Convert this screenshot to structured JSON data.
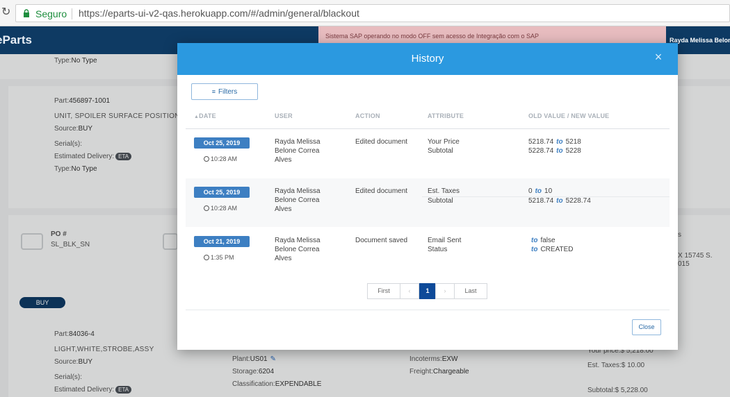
{
  "browser": {
    "secure_label": "Seguro",
    "url": "https://eparts-ui-v2-qas.herokuapp.com/#/admin/general/blackout"
  },
  "app": {
    "brand": "eParts",
    "banner": "Sistema SAP operando no modo OFF sem acesso de Integração com o SAP",
    "user": "Rayda Melissa Belone"
  },
  "background": {
    "type_label_1": "Type:",
    "type_value_1": "No Type",
    "part_label_1": "Part:",
    "part_value_1": "456897-1001",
    "desc_1": "UNIT, SPOILER SURFACE POSITION",
    "source_label_1": "Source:",
    "source_value_1": "BUY",
    "serials_1": "Serial(s):",
    "delivery_label_1": "Estimated Delivery:",
    "eta_1": "ETA",
    "type_label_2": "Type:",
    "type_value_2": "No Type",
    "po_label": "PO #",
    "po_value": "SL_BLK_SN",
    "buy_button": "BUY",
    "part_label_2": "Part:",
    "part_value_2": "84036-4",
    "desc_2": "LIGHT,WHITE,STROBE,ASSY",
    "source_label_2": "Source:",
    "source_value_2": "BUY",
    "serials_2": "Serial(s):",
    "delivery_label_2": "Estimated Delivery:",
    "eta_2": "ETA",
    "plant_label": "Plant:",
    "plant_value": "US01",
    "storage_label": "Storage:",
    "storage_value": "6204",
    "class_label": "Classification:",
    "class_value": "EXPENDABLE",
    "incoterms_label": "Incoterms:",
    "incoterms_value": "EXW",
    "freight_label": "Freight:",
    "freight_value": "Chargeable",
    "your_price": "Your price:$ 5,218.00",
    "est_taxes": "Est. Taxes:$ 10.00",
    "subtotal": "Subtotal:$ 5,228.00",
    "address_partial": "X 15745 S.",
    "address_partial_2": "015",
    "s_partial": "s"
  },
  "modal": {
    "title": "History",
    "filters_label": "Filters",
    "columns": {
      "date": "DATE",
      "user": "USER",
      "action": "ACTION",
      "attribute": "ATTRIBUTE",
      "values": "OLD VALUE / NEW VALUE"
    },
    "to_word": "to",
    "rows": [
      {
        "date": "Oct 25, 2019",
        "time": "10:28 AM",
        "user_1": "Rayda Melissa",
        "user_2": "Belone Correa",
        "user_3": "Alves",
        "action": "Edited document",
        "attr_1": "Your Price",
        "attr_2": "Subtotal",
        "old_1": "5218.74",
        "new_1": "5218",
        "old_2": "5228.74",
        "new_2": "5228"
      },
      {
        "date": "Oct 25, 2019",
        "time": "10:28 AM",
        "user_1": "Rayda Melissa",
        "user_2": "Belone Correa",
        "user_3": "Alves",
        "action": "Edited document",
        "attr_1": "Est. Taxes",
        "attr_2": "Subtotal",
        "old_1": "0",
        "new_1": "10",
        "old_2": "5218.74",
        "new_2": "5228.74"
      },
      {
        "date": "Oct 21, 2019",
        "time": "1:35 PM",
        "user_1": "Rayda Melissa",
        "user_2": "Belone Correa",
        "user_3": "Alves",
        "action": "Document saved",
        "attr_1": "Email Sent",
        "attr_2": "Status",
        "old_1": "",
        "new_1": "false",
        "old_2": "",
        "new_2": "CREATED"
      }
    ],
    "pager": {
      "first": "First",
      "prev": "‹",
      "page": "1",
      "next": "›",
      "last": "Last"
    },
    "close_label": "Close"
  }
}
